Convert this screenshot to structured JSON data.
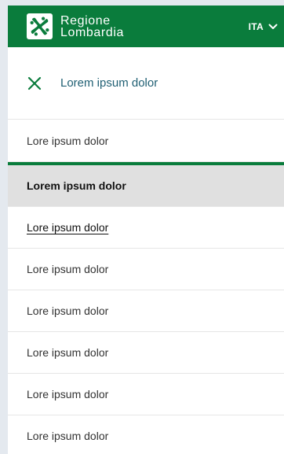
{
  "colors": {
    "brand_green": "#0a7c3c",
    "accent_text": "#1f5f73",
    "item_text": "#333333",
    "active_bg": "#e0e0e0"
  },
  "header": {
    "logo_icon": "rosa-camuna-logo-icon",
    "brand_line1": "Regione",
    "brand_line2": "Lombardia",
    "language_label": "ITA",
    "language_icon": "chevron-down-icon"
  },
  "close_row": {
    "icon": "close-icon",
    "label": "Lorem ipsum dolor"
  },
  "menu": {
    "items": [
      {
        "label": "Lore ipsum dolor",
        "state": "default"
      },
      {
        "label": "Lorem ipsum dolor",
        "state": "active"
      },
      {
        "label": "Lore ipsum dolor",
        "state": "underlined"
      },
      {
        "label": "Lore ipsum dolor",
        "state": "default"
      },
      {
        "label": "Lore ipsum dolor",
        "state": "default"
      },
      {
        "label": "Lore ipsum dolor",
        "state": "default"
      },
      {
        "label": "Lore ipsum dolor",
        "state": "default"
      },
      {
        "label": "Lore ipsum dolor",
        "state": "default"
      }
    ]
  }
}
